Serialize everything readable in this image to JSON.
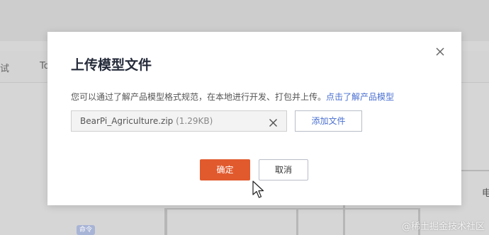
{
  "background": {
    "tab_left": "试",
    "tab_right": "To",
    "side_text": "电",
    "chip_label": "命令"
  },
  "watermark": "@稀土掘金技术社区",
  "modal": {
    "title": "上传模型文件",
    "description": "您可以通过了解产品模型格式规范，在本地进行开发、打包并上传。",
    "description_link": "点击了解产品模型",
    "file": {
      "name": "BearPi_Agriculture.zip",
      "size": "(1.29KB)"
    },
    "add_file_label": "添加文件",
    "confirm_label": "确定",
    "cancel_label": "取消"
  },
  "colors": {
    "primary": "#e15a2e",
    "link": "#4a6fd0"
  },
  "icons": [
    "close-icon",
    "remove-file-icon",
    "mouse-cursor-icon"
  ]
}
